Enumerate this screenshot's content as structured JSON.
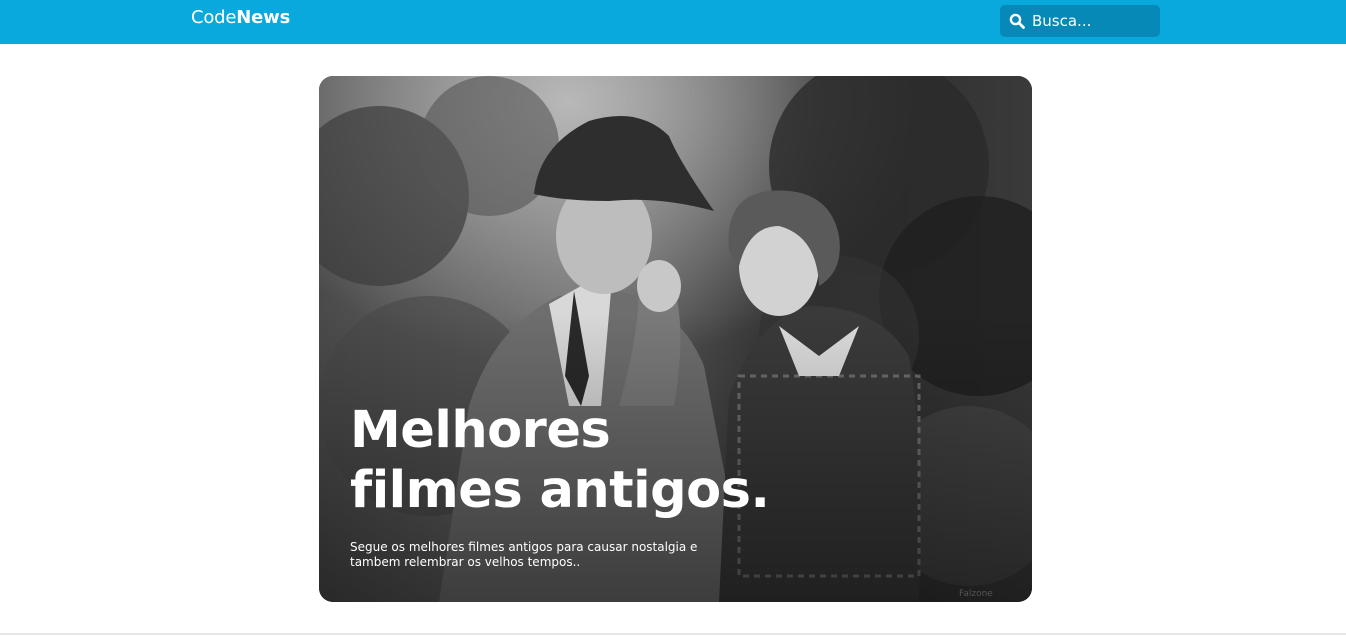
{
  "header": {
    "logo_light": "Code",
    "logo_bold": "News",
    "search": {
      "placeholder": "Busca...",
      "icon": "search-icon"
    },
    "background_color": "#0aa9dd",
    "search_background_color": "#0689b6"
  },
  "hero": {
    "title_line1": "Melhores",
    "title_line2": "filmes antigos.",
    "description": "Segue os melhores filmes antigos para causar nostalgia e tambem relembrar os velhos tempos..",
    "image": "black-and-white-photo-couple-man-hat-eating-carrot"
  }
}
